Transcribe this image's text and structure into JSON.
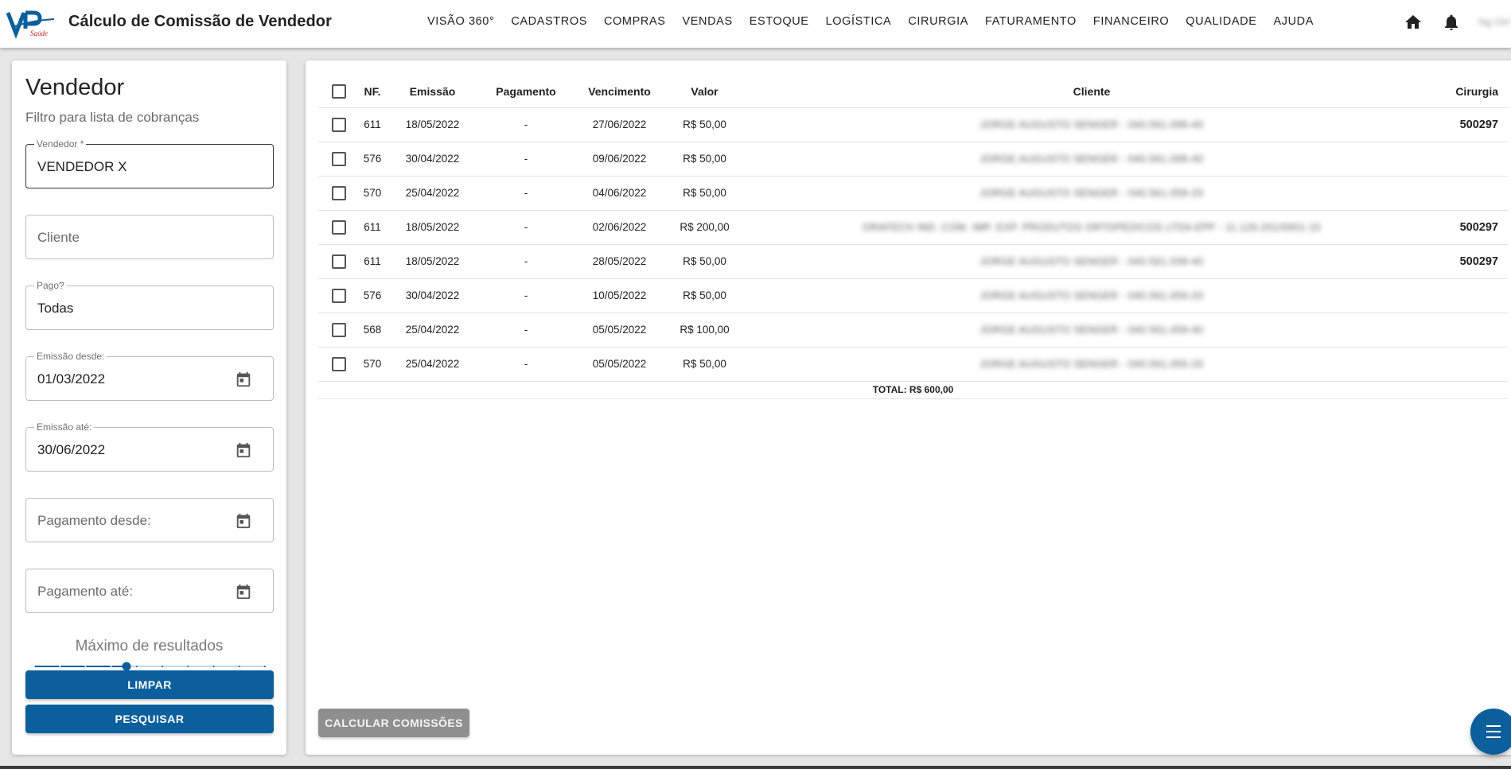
{
  "header": {
    "title": "Cálculo de Comissão de Vendedor",
    "logo_text": "VP",
    "logo_subtext": "Saúde",
    "nav": [
      "VISÃO 360°",
      "CADASTROS",
      "COMPRAS",
      "VENDAS",
      "ESTOQUE",
      "LOGÍSTICA",
      "CIRURGIA",
      "FATURAMENTO",
      "FINANCEIRO",
      "QUALIDADE",
      "AJUDA"
    ],
    "user": "Ng OH",
    "icons": [
      "home-icon",
      "bell-icon"
    ]
  },
  "filter": {
    "title": "Vendedor",
    "subtitle": "Filtro para lista de cobranças",
    "vendedor_label": "Vendedor *",
    "vendedor_value": "VENDEDOR X",
    "cliente_placeholder": "Cliente",
    "pago_label": "Pago?",
    "pago_value": "Todas",
    "emissao_desde_label": "Emissão desde:",
    "emissao_desde_value": "01/03/2022",
    "emissao_ate_label": "Emissão até:",
    "emissao_ate_value": "30/06/2022",
    "pagamento_desde_placeholder": "Pagamento desde:",
    "pagamento_ate_placeholder": "Pagamento até:",
    "max_results_label": "Máximo de resultados",
    "max_results_level": 0.4,
    "clear_label": "LIMPAR",
    "search_label": "PESQUISAR"
  },
  "table": {
    "headers": {
      "nf": "NF.",
      "emissao": "Emissão",
      "pagamento": "Pagamento",
      "vencimento": "Vencimento",
      "valor": "Valor",
      "cliente": "Cliente",
      "cirurgia": "Cirurgia"
    },
    "rows": [
      {
        "nf": "611",
        "emissao": "18/05/2022",
        "pagamento": "-",
        "vencimento": "27/06/2022",
        "valor": "R$ 50,00",
        "cliente": "JORGE AUGUSTO SENGER - 040.561.099-40",
        "cirurgia": "500297"
      },
      {
        "nf": "576",
        "emissao": "30/04/2022",
        "pagamento": "-",
        "vencimento": "09/06/2022",
        "valor": "R$ 50,00",
        "cliente": "JORGE AUGUSTO SENGER - 040.561.099-40",
        "cirurgia": ""
      },
      {
        "nf": "570",
        "emissao": "25/04/2022",
        "pagamento": "-",
        "vencimento": "04/06/2022",
        "valor": "R$ 50,00",
        "cliente": "JORGE AUGUSTO SENGER - 040.561.059-20",
        "cirurgia": ""
      },
      {
        "nf": "611",
        "emissao": "18/05/2022",
        "pagamento": "-",
        "vencimento": "02/06/2022",
        "valor": "R$ 200,00",
        "cliente": "ORAFECH IND. COM. IMP. EXP. PRODUTOS ORTOPEDICOS LTDA EPP - 11.126.201/0001-10",
        "cirurgia": "500297"
      },
      {
        "nf": "611",
        "emissao": "18/05/2022",
        "pagamento": "-",
        "vencimento": "28/05/2022",
        "valor": "R$ 50,00",
        "cliente": "JORGE AUGUSTO SENGER - 040.561.039-40",
        "cirurgia": "500297"
      },
      {
        "nf": "576",
        "emissao": "30/04/2022",
        "pagamento": "-",
        "vencimento": "10/05/2022",
        "valor": "R$ 50,00",
        "cliente": "JORGE AUGUSTO SENGER - 040.561.059-20",
        "cirurgia": ""
      },
      {
        "nf": "568",
        "emissao": "25/04/2022",
        "pagamento": "-",
        "vencimento": "05/05/2022",
        "valor": "R$ 100,00",
        "cliente": "JORGE AUGUSTO SENGER - 040.561.059-40",
        "cirurgia": ""
      },
      {
        "nf": "570",
        "emissao": "25/04/2022",
        "pagamento": "-",
        "vencimento": "05/05/2022",
        "valor": "R$ 50,00",
        "cliente": "JORGE AUGUSTO SENGER - 040.561.055-20",
        "cirurgia": ""
      }
    ],
    "total": "TOTAL: R$ 600,00"
  },
  "actions": {
    "calc_label": "CALCULAR COMISSÕES",
    "fab_icon": "menu-icon"
  },
  "colors": {
    "primary": "#0b5f9c",
    "disabled": "#8f8f8f"
  }
}
